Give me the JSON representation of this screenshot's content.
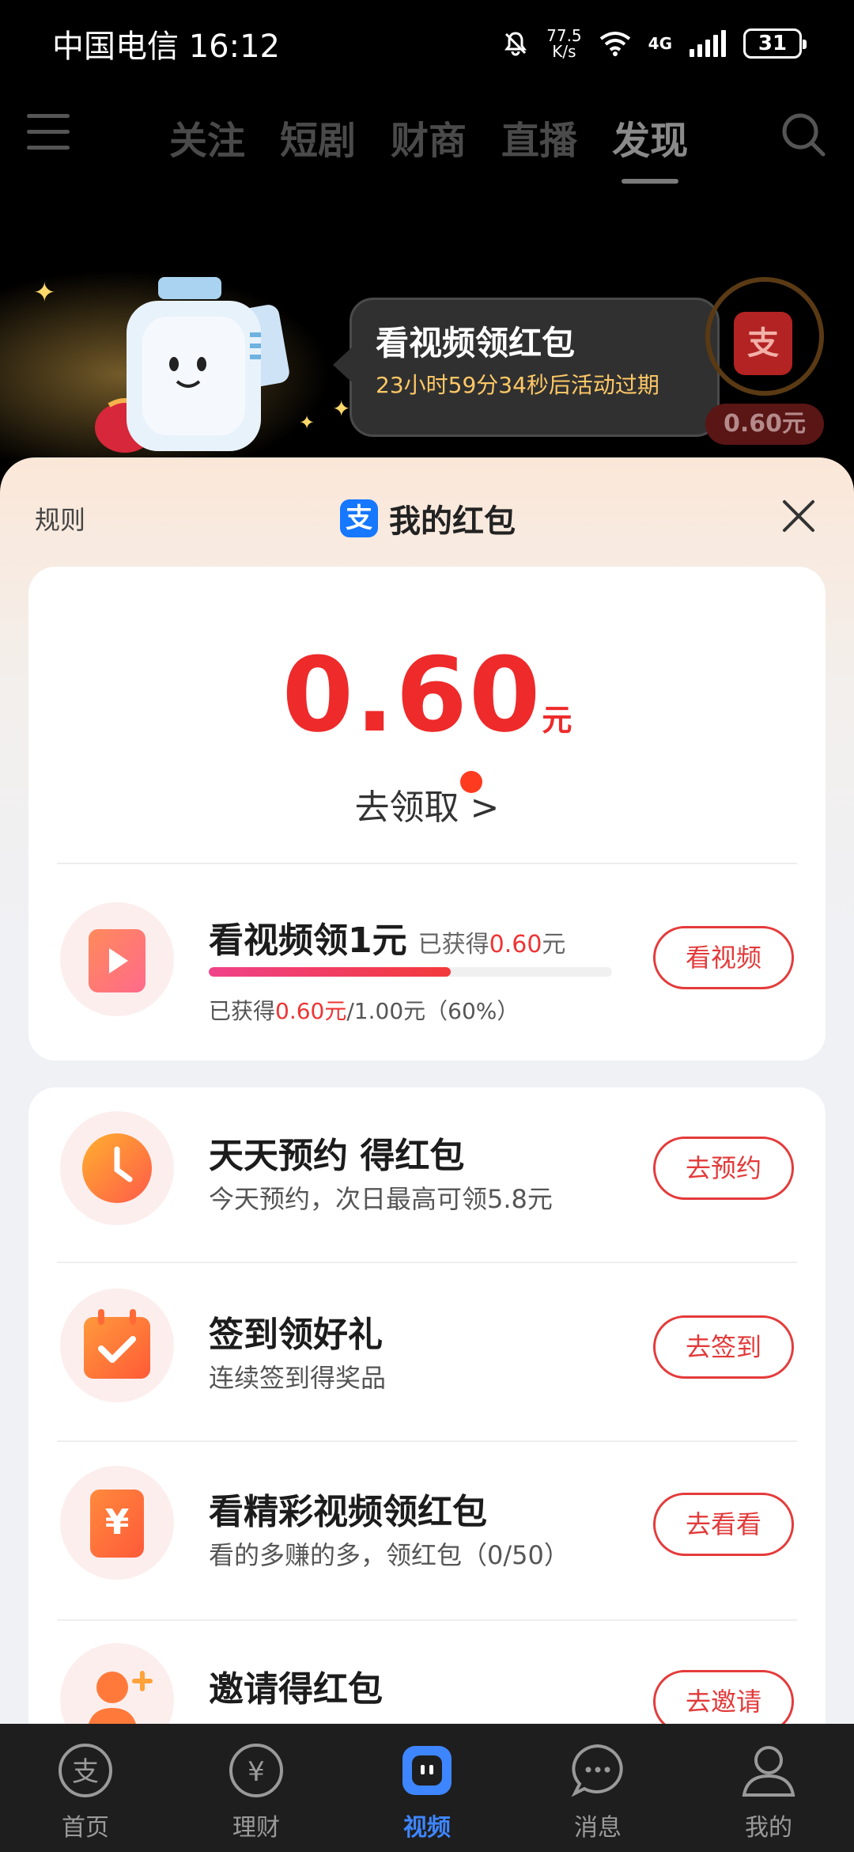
{
  "status_bar": {
    "carrier_time": "中国电信 16:12",
    "net_speed_value": "77.5",
    "net_speed_unit": "K/s",
    "network": "4G",
    "battery": "31"
  },
  "top_nav": {
    "tabs": [
      "关注",
      "短剧",
      "财商",
      "直播",
      "发现"
    ],
    "active_tab": "发现"
  },
  "banner": {
    "title": "看视频领红包",
    "countdown": "23小时59分34秒后活动过期",
    "side_amount": "0.60元",
    "side_icon_char": "支"
  },
  "sheet": {
    "rules_label": "规则",
    "title": "我的红包",
    "logo_char": "支",
    "amount": "0.60",
    "amount_unit": "元",
    "claim_label": "去领取 >"
  },
  "video_task": {
    "title": "看视频领1元",
    "earned_prefix": "已获得",
    "earned_value": "0.60",
    "earned_unit": "元",
    "progress_prefix": "已获得",
    "progress_value": "0.60元",
    "progress_suffix": "/1.00元（60%）",
    "progress_fraction": 0.6,
    "button": "看视频"
  },
  "tasks": [
    {
      "title": "天天预约 得红包",
      "subtitle": "今天预约，次日最高可领5.8元",
      "button": "去预约"
    },
    {
      "title": "签到领好礼",
      "subtitle": "连续签到得奖品",
      "button": "去签到"
    },
    {
      "title": "看精彩视频领红包",
      "subtitle": "看的多赚的多，领红包（0/50）",
      "button": "去看看"
    },
    {
      "title": "邀请得红包",
      "subtitle": "",
      "button": "去邀请"
    }
  ],
  "bottom_nav": {
    "items": [
      "首页",
      "理财",
      "视频",
      "消息",
      "我的"
    ],
    "active": "视频"
  },
  "colors": {
    "accent_red": "#ee2a2a",
    "active_blue": "#3e86ff",
    "progress_gradient": [
      "#f0428a",
      "#f23a3a"
    ]
  }
}
